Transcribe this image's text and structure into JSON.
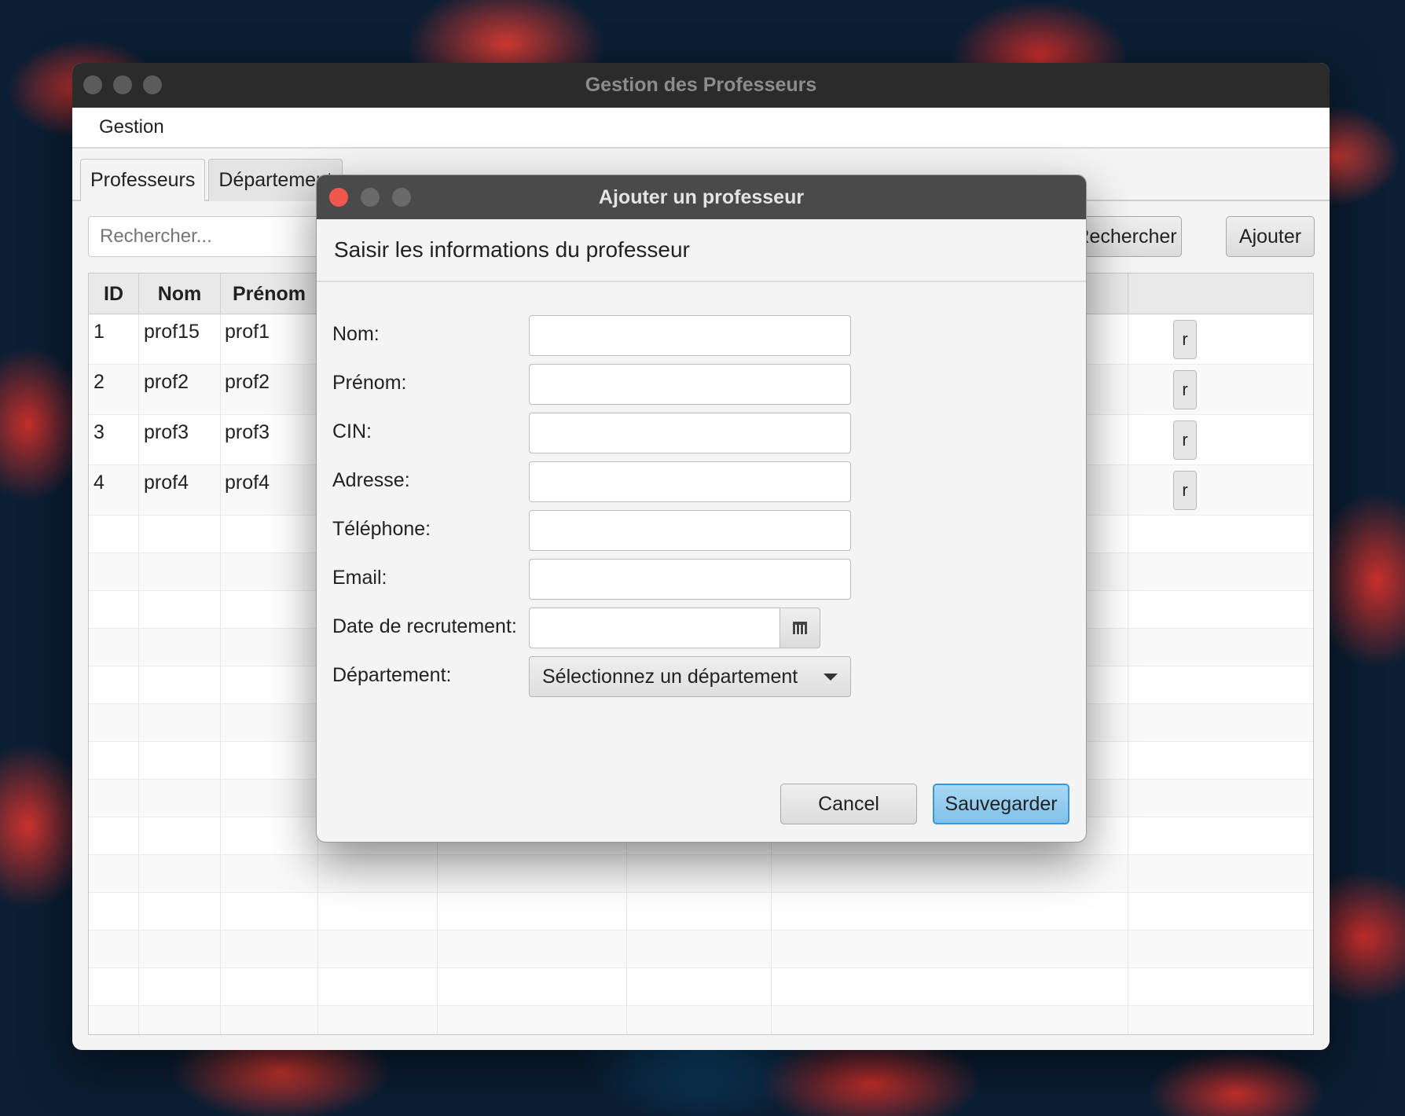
{
  "main_window": {
    "title": "Gestion des Professeurs",
    "menu": [
      "Gestion"
    ],
    "tabs": [
      "Professeurs",
      "Département"
    ],
    "search_placeholder": "Rechercher...",
    "search_button": "Rechercher",
    "add_button": "Ajouter",
    "table": {
      "columns": [
        "ID",
        "Nom",
        "Prénom"
      ],
      "rows": [
        {
          "id": "1",
          "nom": "prof15",
          "prenom": "prof1"
        },
        {
          "id": "2",
          "nom": "prof2",
          "prenom": "prof2"
        },
        {
          "id": "3",
          "nom": "prof3",
          "prenom": "prof3"
        },
        {
          "id": "4",
          "nom": "prof4",
          "prenom": "prof4"
        }
      ],
      "row_button_partial": "r"
    }
  },
  "dialog": {
    "title": "Ajouter un professeur",
    "header": "Saisir les informations du professeur",
    "fields": [
      {
        "label": "Nom:",
        "value": ""
      },
      {
        "label": "Prénom:",
        "value": ""
      },
      {
        "label": "CIN:",
        "value": ""
      },
      {
        "label": "Adresse:",
        "value": ""
      },
      {
        "label": "Téléphone:",
        "value": ""
      },
      {
        "label": "Email:",
        "value": ""
      },
      {
        "label": "Date de recrutement:",
        "value": ""
      },
      {
        "label": "Département:",
        "value": "Sélectionnez un département"
      }
    ],
    "cancel_button": "Cancel",
    "save_button": "Sauvegarder"
  },
  "icons": {
    "date_picker": "calendar-icon",
    "dropdown": "chevron-down-icon"
  },
  "colors": {
    "accent": "#3c98d3",
    "close_button": "#f0584f"
  }
}
